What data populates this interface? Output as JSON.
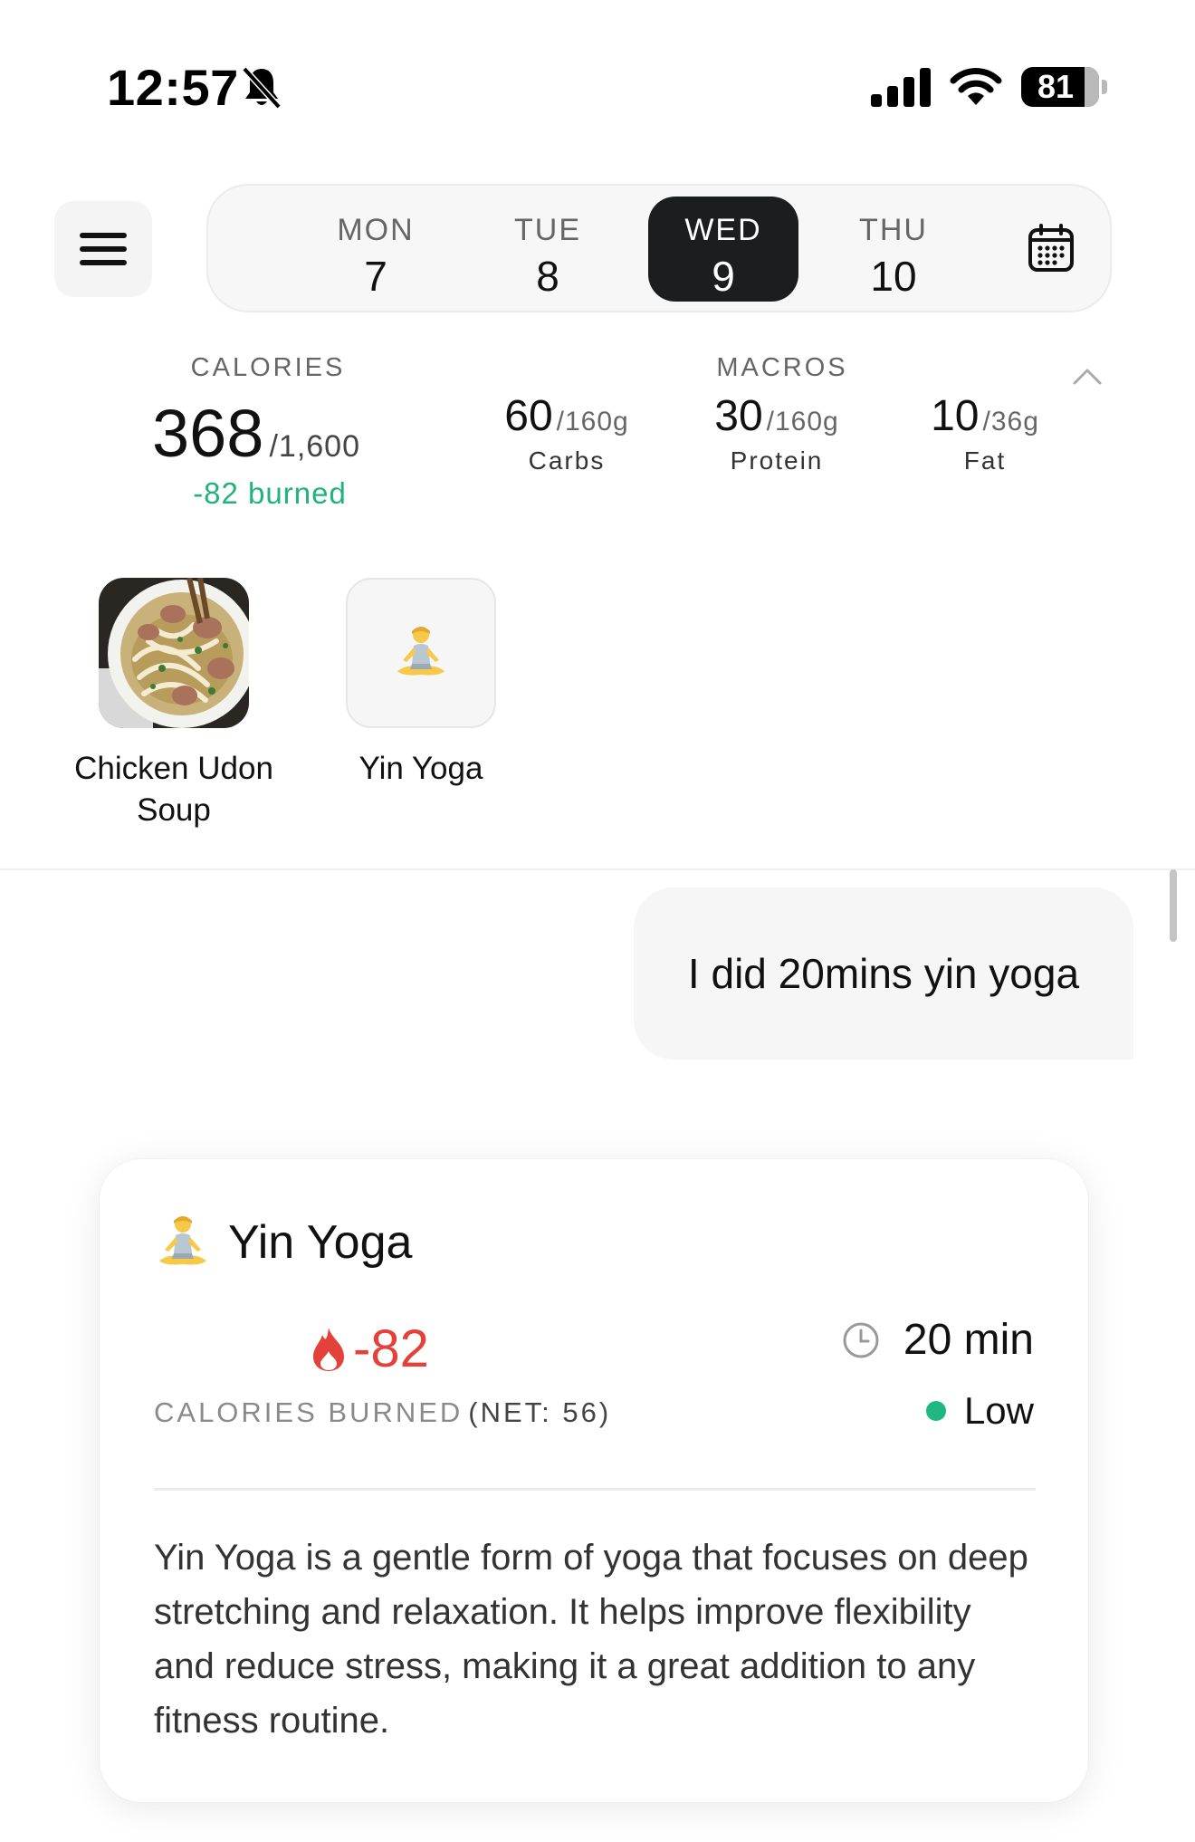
{
  "status_bar": {
    "time": "12:57",
    "battery": "81",
    "battery_level": 0.81,
    "icons": [
      "bell-slash-icon",
      "cellular-signal-icon",
      "wifi-icon",
      "battery-icon"
    ]
  },
  "header": {
    "menu_icon": "hamburger-menu-icon",
    "days": [
      {
        "name": "MON",
        "num": "7",
        "selected": false
      },
      {
        "name": "TUE",
        "num": "8",
        "selected": false
      },
      {
        "name": "WED",
        "num": "9",
        "selected": true
      },
      {
        "name": "THU",
        "num": "10",
        "selected": false
      }
    ],
    "calendar_icon": "calendar-icon"
  },
  "summary": {
    "calories_label": "CALORIES",
    "calories_value": "368",
    "calories_goal": "/1,600",
    "burned": "-82 burned",
    "macros_label": "MACROS",
    "macros": [
      {
        "value": "60",
        "goal": "/160g",
        "name": "Carbs"
      },
      {
        "value": "30",
        "goal": "/160g",
        "name": "Protein"
      },
      {
        "value": "10",
        "goal": "/36g",
        "name": "Fat"
      }
    ],
    "collapse_icon": "chevron-up-icon"
  },
  "entries": [
    {
      "label": "Chicken Udon Soup",
      "kind": "food-photo"
    },
    {
      "label": "Yin Yoga",
      "kind": "emoji",
      "emoji": "🧘"
    }
  ],
  "chat": {
    "user_message": "I did 20mins yin yoga"
  },
  "activity_card": {
    "emoji": "🧘",
    "title": "Yin Yoga",
    "calories_burned": "-82",
    "calories_label": "CALORIES BURNED",
    "net": "(NET: 56)",
    "duration": "20 min",
    "intensity": "Low",
    "description": "Yin Yoga is a gentle form of yoga that focuses on deep stretching and relaxation. It helps improve flexibility and reduce stress, making it a great addition to any fitness routine."
  },
  "colors": {
    "accent_green": "#21b37c",
    "burn_red": "#e4413b",
    "selected_day_bg": "#1b1d1f"
  }
}
